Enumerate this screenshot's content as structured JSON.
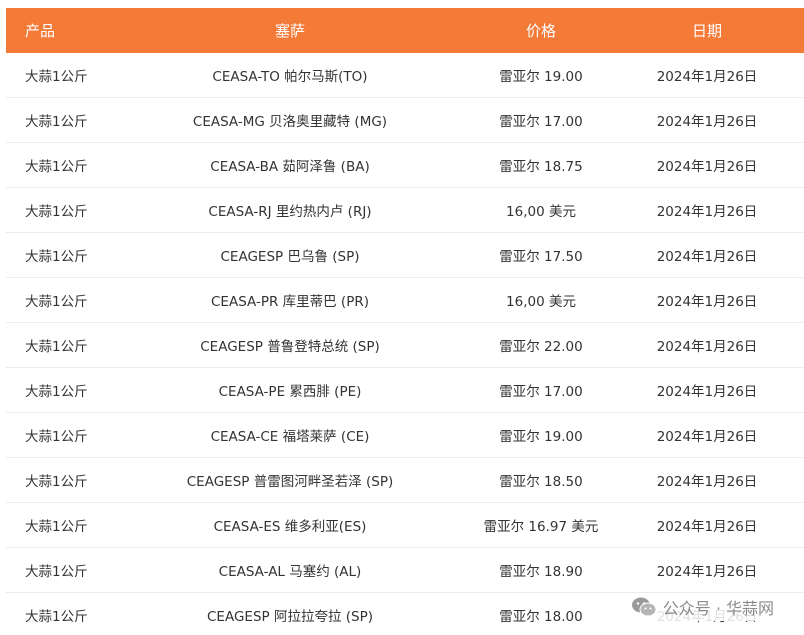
{
  "table": {
    "headers": {
      "product": "产品",
      "ceasa": "塞萨",
      "price": "价格",
      "date": "日期"
    },
    "rows": [
      {
        "product": "大蒜1公斤",
        "ceasa": "CEASA-TO 帕尔马斯(TO)",
        "price": "雷亚尔 19.00",
        "date": "2024年1月26日"
      },
      {
        "product": "大蒜1公斤",
        "ceasa": "CEASA-MG 贝洛奥里藏特 (MG)",
        "price": "雷亚尔 17.00",
        "date": "2024年1月26日"
      },
      {
        "product": "大蒜1公斤",
        "ceasa": "CEASA-BA 茹阿泽鲁 (BA)",
        "price": "雷亚尔 18.75",
        "date": "2024年1月26日"
      },
      {
        "product": "大蒜1公斤",
        "ceasa": "CEASA-RJ 里约热内卢 (RJ)",
        "price": "16,00 美元",
        "date": "2024年1月26日"
      },
      {
        "product": "大蒜1公斤",
        "ceasa": "CEAGESP 巴乌鲁 (SP)",
        "price": "雷亚尔 17.50",
        "date": "2024年1月26日"
      },
      {
        "product": "大蒜1公斤",
        "ceasa": "CEASA-PR 库里蒂巴 (PR)",
        "price": "16,00 美元",
        "date": "2024年1月26日"
      },
      {
        "product": "大蒜1公斤",
        "ceasa": "CEAGESP 普鲁登特总统 (SP)",
        "price": "雷亚尔 22.00",
        "date": "2024年1月26日"
      },
      {
        "product": "大蒜1公斤",
        "ceasa": "CEASA-PE 累西腓 (PE)",
        "price": "雷亚尔 17.00",
        "date": "2024年1月26日"
      },
      {
        "product": "大蒜1公斤",
        "ceasa": "CEASA-CE 福塔莱萨 (CE)",
        "price": "雷亚尔 19.00",
        "date": "2024年1月26日"
      },
      {
        "product": "大蒜1公斤",
        "ceasa": "CEAGESP 普雷图河畔圣若泽 (SP)",
        "price": "雷亚尔 18.50",
        "date": "2024年1月26日"
      },
      {
        "product": "大蒜1公斤",
        "ceasa": "CEASA-ES 维多利亚(ES)",
        "price": "雷亚尔 16.97 美元",
        "date": "2024年1月26日"
      },
      {
        "product": "大蒜1公斤",
        "ceasa": "CEASA-AL 马塞约 (AL)",
        "price": "雷亚尔 18.90",
        "date": "2024年1月26日"
      },
      {
        "product": "大蒜1公斤",
        "ceasa": "CEAGESP 阿拉拉夸拉 (SP)",
        "price": "雷亚尔 18.00",
        "date": "2024年1月26日"
      }
    ]
  },
  "watermark": {
    "icon": "wechat-icon",
    "text": "公众号 · 华蒜网"
  },
  "colors": {
    "header_bg": "#f47a38",
    "header_text": "#ffffff"
  }
}
